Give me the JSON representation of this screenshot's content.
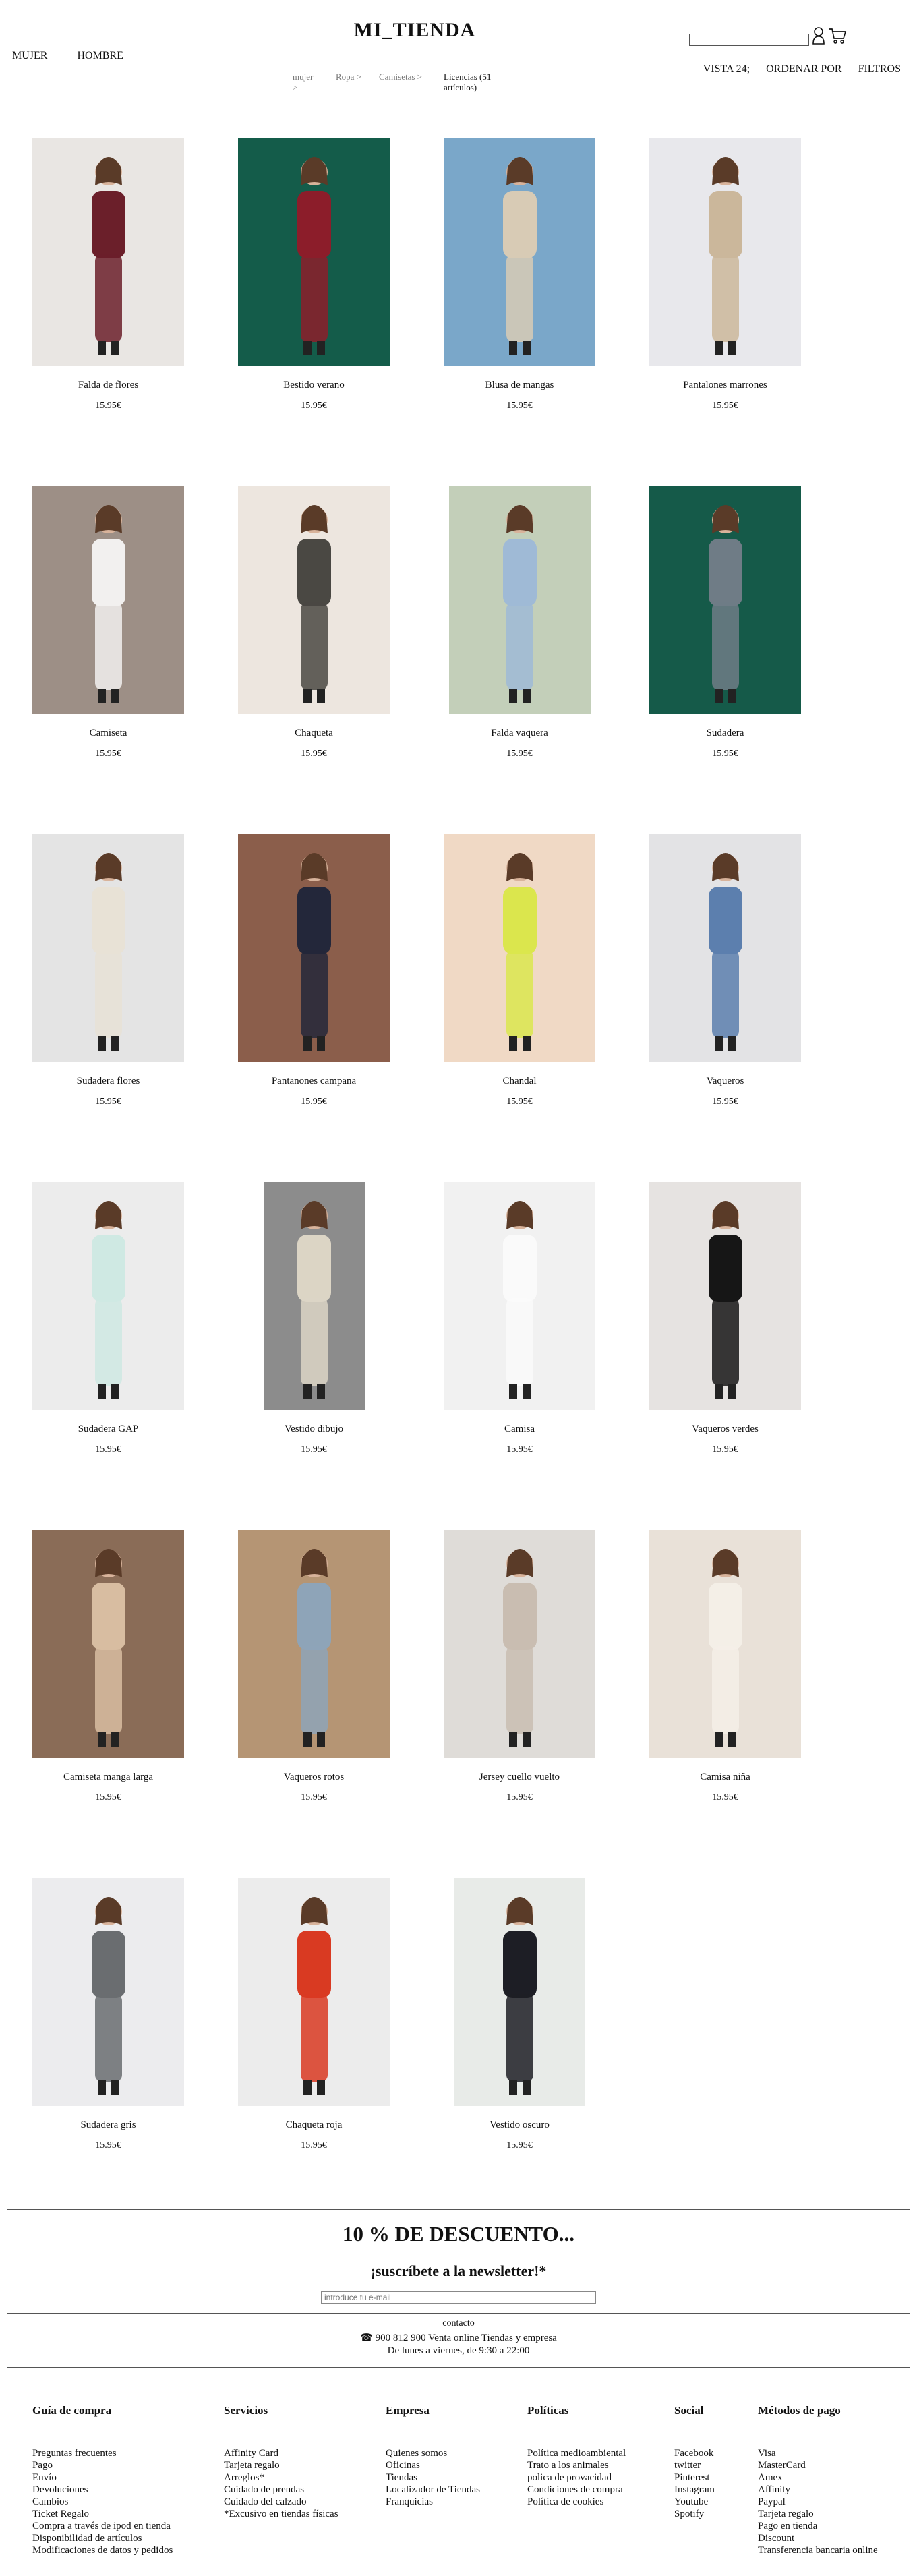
{
  "brand": "MI_TIENDA",
  "nav": {
    "women": "MUJER",
    "men": "HOMBRE"
  },
  "breadcrumb": [
    "mujer >",
    "Ropa >",
    "Camisetas >"
  ],
  "breadcrumb_current": "Licencias (51 artículos)",
  "search": {
    "value": "",
    "placeholder": ""
  },
  "tools": {
    "view": "VISTA 24;",
    "sort": "ORDENAR POR",
    "filters": "FILTROS"
  },
  "currency_price": "15.95€",
  "products": [
    {
      "name": "Falda de flores",
      "price": "15.95€",
      "bg": "#e9e6e3",
      "wear": "#6b1f2a"
    },
    {
      "name": "Bestido verano",
      "price": "15.95€",
      "bg": "#145c4a",
      "wear": "#8c1d2a"
    },
    {
      "name": "Blusa de mangas",
      "price": "15.95€",
      "bg": "#7aa7c9",
      "wear": "#d8cbb5"
    },
    {
      "name": "Pantalones marrones",
      "price": "15.95€",
      "bg": "#e8e8ec",
      "wear": "#cbb79b"
    },
    {
      "name": "Camiseta",
      "price": "15.95€",
      "bg": "#9d8f86",
      "wear": "#f2f0ef"
    },
    {
      "name": "Chaqueta",
      "price": "15.95€",
      "bg": "#ede6df",
      "wear": "#4a4843"
    },
    {
      "name": "Falda vaquera",
      "price": "15.95€",
      "bg": "#c3cfb9",
      "wear": "#9fbad6"
    },
    {
      "name": "Sudadera",
      "price": "15.95€",
      "bg": "#155a49",
      "wear": "#6f7c86"
    },
    {
      "name": "Sudadera flores",
      "price": "15.95€",
      "bg": "#e4e4e4",
      "wear": "#e8e2d6"
    },
    {
      "name": "Pantanones campana",
      "price": "15.95€",
      "bg": "#8b5e4b",
      "wear": "#23273a"
    },
    {
      "name": "Chandal",
      "price": "15.95€",
      "bg": "#f0d9c5",
      "wear": "#dbe64d"
    },
    {
      "name": "Vaqueros",
      "price": "15.95€",
      "bg": "#e3e3e5",
      "wear": "#5c7fae"
    },
    {
      "name": "Sudadera GAP",
      "price": "15.95€",
      "bg": "#ececec",
      "wear": "#cfe9e3"
    },
    {
      "name": "Vestido dibujo",
      "price": "15.95€",
      "bg": "#8c8c8c",
      "wear": "#dcd5c5"
    },
    {
      "name": "Camisa",
      "price": "15.95€",
      "bg": "#f1f1f1",
      "wear": "#fafafa"
    },
    {
      "name": "Vaqueros verdes",
      "price": "15.95€",
      "bg": "#e6e3e1",
      "wear": "#161616"
    },
    {
      "name": "Camiseta manga larga",
      "price": "15.95€",
      "bg": "#8a6c57",
      "wear": "#d8bda1"
    },
    {
      "name": "Vaqueros rotos",
      "price": "15.95€",
      "bg": "#b59574",
      "wear": "#8ea4b8"
    },
    {
      "name": "Jersey cuello vuelto",
      "price": "15.95€",
      "bg": "#dfdcd8",
      "wear": "#c9bdb1"
    },
    {
      "name": "Camisa niña",
      "price": "15.95€",
      "bg": "#e9e1d8",
      "wear": "#f4efe7"
    },
    {
      "name": "Sudadera gris",
      "price": "15.95€",
      "bg": "#ececee",
      "wear": "#6a6d70"
    },
    {
      "name": "Chaqueta roja",
      "price": "15.95€",
      "bg": "#ececec",
      "wear": "#d93a22"
    },
    {
      "name": "Vestido oscuro",
      "price": "15.95€",
      "bg": "#e8ebe8",
      "wear": "#1d1e25"
    }
  ],
  "promo": "10 % DE DESCUENTO...",
  "newsletter": {
    "title": "¡suscríbete a la newsletter!*",
    "placeholder": "introduce tu e-mail"
  },
  "contact": {
    "label": "contacto",
    "phone_line": "900 812 900 Venta online Tiendas y empresa",
    "hours": "De lunes a viernes, de 9:30 a 22:00"
  },
  "footer": [
    {
      "title": "Guía de compra",
      "items": [
        "Preguntas frecuentes",
        "Pago",
        "Envío",
        "Devoluciones",
        "Cambios",
        "Ticket Regalo",
        "Compra a través de ipod en tienda",
        "Disponibilidad de artículos",
        "Modificaciones de datos y pedidos"
      ]
    },
    {
      "title": "Servicios",
      "items": [
        "Affinity Card",
        "Tarjeta regalo",
        "Arreglos*",
        "Cuidado de prendas",
        "Cuidado del calzado",
        "*Excusivo en tiendas físicas"
      ]
    },
    {
      "title": "Empresa",
      "items": [
        "Quienes somos",
        "Oficinas",
        "Tiendas",
        "Localizador de Tiendas",
        "Franquicias"
      ]
    },
    {
      "title": "Políticas",
      "items": [
        "Política medioambiental",
        "Trato a los animales",
        "polica de provacidad",
        "Condiciones de compra",
        "Política de cookies"
      ]
    },
    {
      "title": "Social",
      "items": [
        "Facebook",
        "twitter",
        "Pinterest",
        "Instagram",
        "Youtube",
        "Spotify"
      ]
    },
    {
      "title": "Métodos de pago",
      "items": [
        "Visa",
        "MasterCard",
        "Amex",
        "Affinity",
        "Paypal",
        "Tarjeta regalo",
        "Pago en tienda",
        "Discount",
        "Transferencia bancaria online"
      ]
    }
  ]
}
